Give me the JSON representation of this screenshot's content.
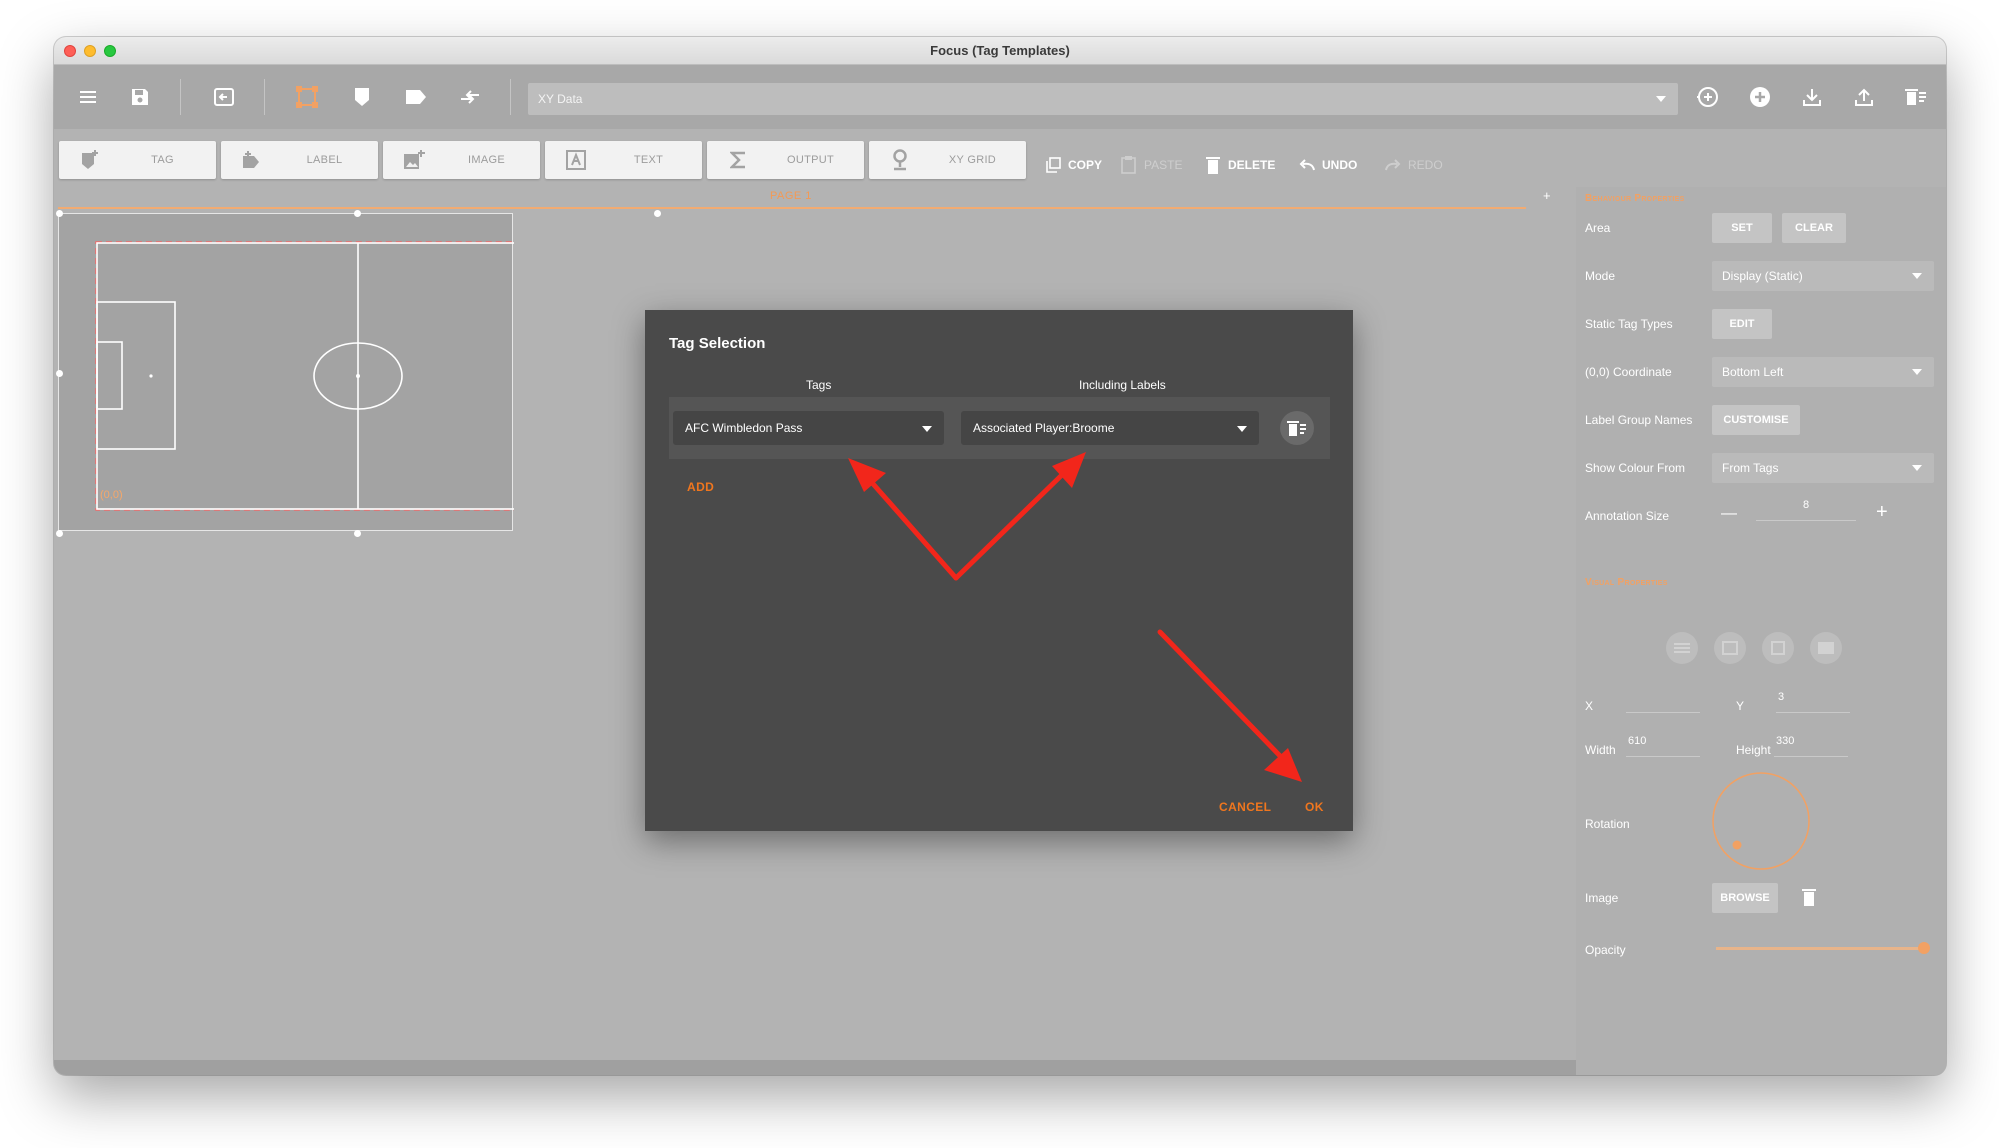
{
  "window": {
    "title": "Focus (Tag Templates)"
  },
  "toolbar": {
    "icons": [
      "menu-icon",
      "save-icon",
      "import-icon",
      "area-select-icon",
      "tag-shape-icon",
      "label-shape-icon",
      "swap-icon"
    ],
    "xy_select_value": "XY Data",
    "right_icons": [
      "add-circle-outline-icon",
      "add-circle-icon",
      "download-icon",
      "upload-icon",
      "delete-list-icon"
    ]
  },
  "tools": {
    "tag": "TAG",
    "label": "LABEL",
    "image": "IMAGE",
    "text": "TEXT",
    "output": "OUTPUT",
    "xy_grid": "XY GRID",
    "copy": "COPY",
    "paste": "PASTE",
    "delete": "DELETE",
    "undo": "UNDO",
    "redo": "REDO"
  },
  "page": {
    "label": "PAGE 1",
    "add": "+"
  },
  "canvas": {
    "origin_label": "(0,0)"
  },
  "right_panel": {
    "behaviour_header": "Behaviour Properties",
    "area_label": "Area",
    "set": "SET",
    "clear": "CLEAR",
    "mode_label": "Mode",
    "mode_value": "Display (Static)",
    "static_tag_types_label": "Static Tag Types",
    "edit": "EDIT",
    "coordinate_label": "(0,0) Coordinate",
    "coordinate_value": "Bottom Left",
    "label_group_names_label": "Label Group Names",
    "customise": "CUSTOMISE",
    "show_colour_label": "Show Colour From",
    "show_colour_value": "From Tags",
    "annotation_size_label": "Annotation Size",
    "annotation_size_value": "8",
    "minus": "—",
    "plus": "+",
    "visual_header": "Visual Properties",
    "x_label": "X",
    "x_value": "",
    "y_label": "Y",
    "y_value": "3",
    "width_label": "Width",
    "width_value": "610",
    "height_label": "Height",
    "height_value": "330",
    "rotation_label": "Rotation",
    "image_label": "Image",
    "browse": "BROWSE",
    "opacity_label": "Opacity",
    "opacity_level": 1.0
  },
  "dialog": {
    "title": "Tag Selection",
    "tags_header": "Tags",
    "labels_header": "Including Labels",
    "tag_value": "AFC Wimbledon Pass",
    "label_value": "Associated Player:Broome",
    "add": "ADD",
    "cancel": "CANCEL",
    "ok": "OK"
  },
  "colors": {
    "accent": "#f0761e",
    "annotation_arrow": "#f2261b",
    "dialog_bg": "#4a4a4a",
    "window_bg": "#b3b3b3"
  }
}
